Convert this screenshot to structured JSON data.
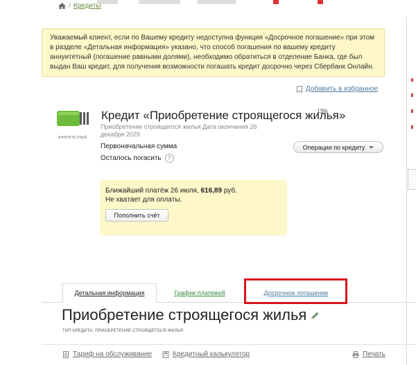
{
  "breadcrumb": {
    "link": "Кредиты"
  },
  "notice": {
    "text": "Уважаемый клиент, если по Вашему кредиту недоступна функция «Досрочное погашение» при этом в разделе «Детальная информация» указано, что способ погашения по вашему кредиту аннуитетный (погашение равными долями), необходимо обратиться в отделение Банка, где был выдан Ваш кредит, для получения возможности погашать кредит досрочно через Сбербанк Онлайн."
  },
  "favorites": {
    "label": "Добавить в избранное"
  },
  "credit": {
    "icon_caption": "АННУИТЕТНЫЙ",
    "title": "Кредит «Приобретение строящегося жилья»",
    "rate": "13%",
    "subtitle": "Приобретение строящегося жилья Дата окончания 26 декабря 2029",
    "initial_amount_label": "Первоначальная сумма",
    "remaining_label": "Осталось погасить",
    "help_glyph": "?",
    "operations_button": "Операции по кредиту"
  },
  "payment": {
    "prefix": "Ближайший платёж 26 июля,",
    "amount": "616,89",
    "currency": "руб.",
    "insufficient": "Не хватает для оплаты.",
    "topup_button": "Пополнить счёт"
  },
  "tabs": [
    {
      "label": "Детальная информация",
      "active": true
    },
    {
      "label": "График платежей",
      "active": false
    },
    {
      "label": "Досрочное погашение",
      "active": false
    }
  ],
  "section": {
    "title": "Приобретение строящегося жилья",
    "credit_type": "ТИП КРЕДИТА: ПРИОБРЕТЕНИЕ СТРОЯЩЕГОСЯ ЖИЛЬЯ"
  },
  "footer": {
    "tariff": "Тариф на обслуживание",
    "calculator": "Кредитный калькулятор",
    "print": "Печать"
  },
  "colors": {
    "notice_bg": "#fdf7c9",
    "highlight_red": "#d8141d",
    "link_green": "#3a8a3a",
    "link_blue": "#4c7a9e",
    "wallet_green": "#6dbb3c"
  }
}
